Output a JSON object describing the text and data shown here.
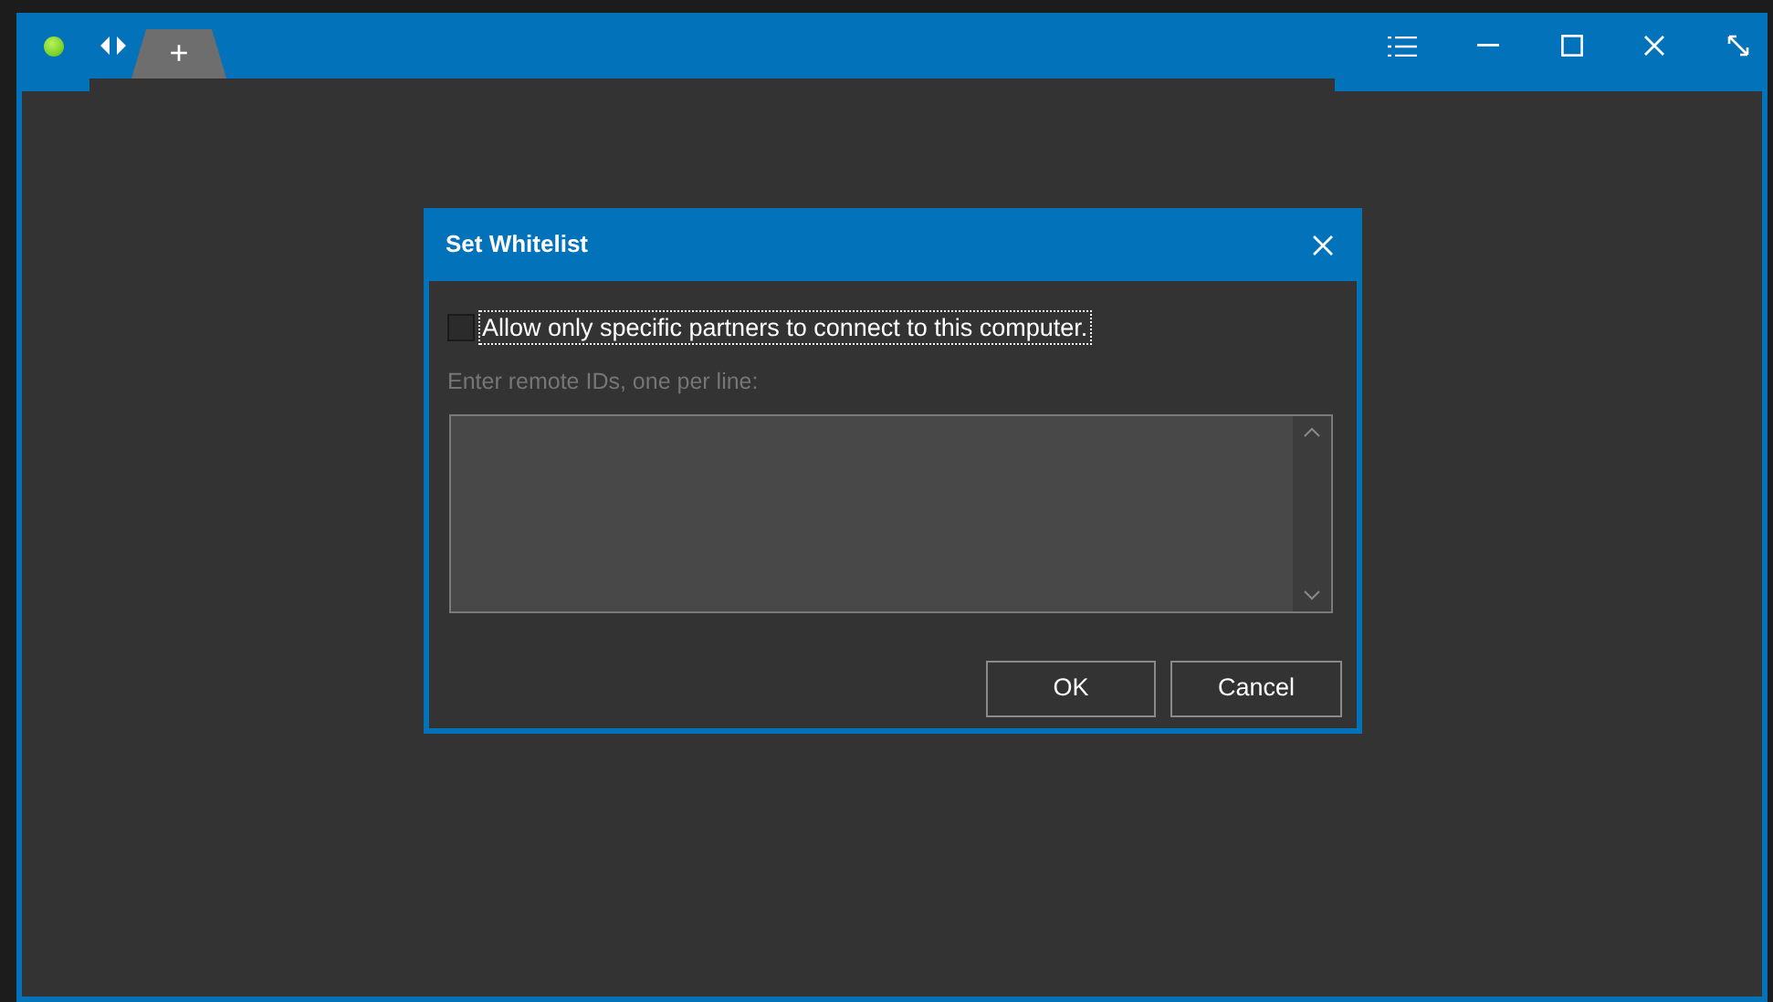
{
  "window": {
    "connected": true,
    "new_tab": "+"
  },
  "dialog": {
    "title": "Set Whitelist",
    "checkbox": {
      "label": "Allow only specific partners to connect to this computer.",
      "checked": false
    },
    "ids_label": "Enter remote IDs, one per line:",
    "buttons": [
      "OK",
      "Cancel"
    ]
  }
}
